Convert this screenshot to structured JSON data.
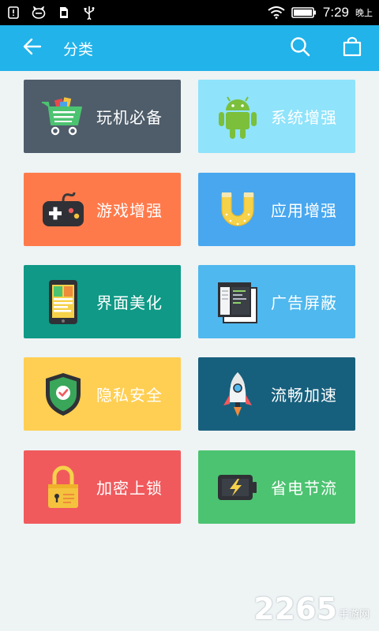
{
  "status_bar": {
    "time": "7:29",
    "ampm": "晚上",
    "icons": [
      "alert-icon",
      "cat-icon",
      "sim-icon",
      "usb-icon",
      "wifi-icon",
      "battery-icon"
    ]
  },
  "app_bar": {
    "title": "分类",
    "back_icon": "arrow-left-icon",
    "search_icon": "search-icon",
    "bag_icon": "shopping-bag-icon",
    "background": "#21b3ea"
  },
  "categories": [
    {
      "label": "玩机必备",
      "icon": "shopping-cart-icon",
      "color": "#4f5d6a"
    },
    {
      "label": "系统增强",
      "icon": "android-icon",
      "color": "#8fe3fb"
    },
    {
      "label": "游戏增强",
      "icon": "gamepad-icon",
      "color": "#ff7a4b"
    },
    {
      "label": "应用增强",
      "icon": "magnet-icon",
      "color": "#48a7ef"
    },
    {
      "label": "界面美化",
      "icon": "tablet-icon",
      "color": "#0f9986"
    },
    {
      "label": "广告屏蔽",
      "icon": "window-icon",
      "color": "#4fb8ee"
    },
    {
      "label": "隐私安全",
      "icon": "shield-check-icon",
      "color": "#ffcf53"
    },
    {
      "label": "流畅加速",
      "icon": "rocket-icon",
      "color": "#17607d"
    },
    {
      "label": "加密上锁",
      "icon": "padlock-icon",
      "color": "#f05a5d"
    },
    {
      "label": "省电节流",
      "icon": "battery-bolt-icon",
      "color": "#4cc371"
    }
  ],
  "watermark": {
    "number": "2265",
    "text": "手游网"
  }
}
